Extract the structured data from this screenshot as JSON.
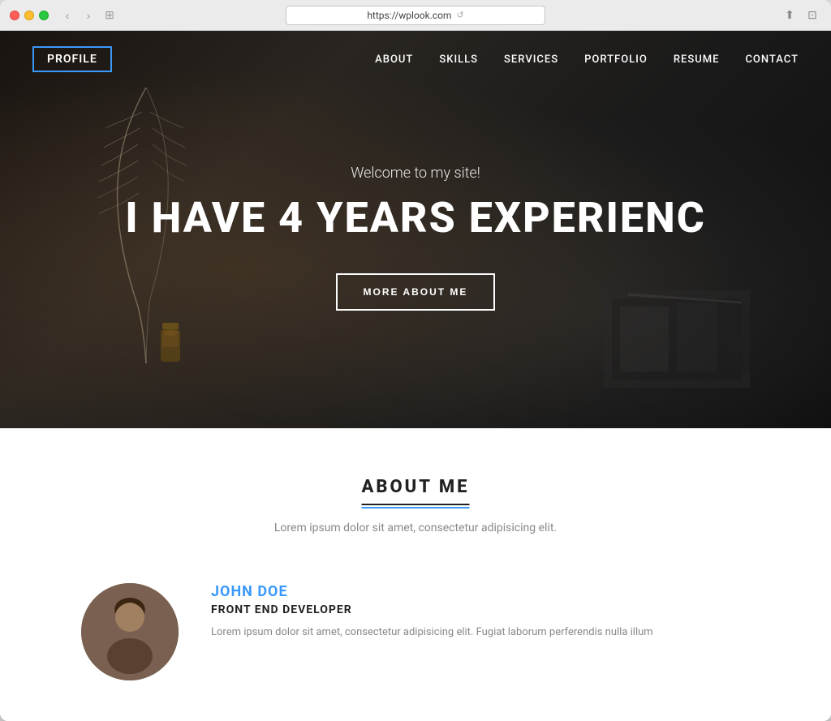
{
  "browser": {
    "url": "https://wplook.com",
    "back_btn": "‹",
    "forward_btn": "›",
    "tab_icon": "⊞",
    "share_icon": "⬆",
    "fullscreen_icon": "⊡"
  },
  "nav": {
    "logo": "PROFILE",
    "links": [
      {
        "label": "ABOUT",
        "href": "#about"
      },
      {
        "label": "SKILLS",
        "href": "#skills"
      },
      {
        "label": "SERVICES",
        "href": "#services"
      },
      {
        "label": "PORTFOLIO",
        "href": "#portfolio"
      },
      {
        "label": "RESUME",
        "href": "#resume"
      },
      {
        "label": "CONTACT",
        "href": "#contact"
      }
    ]
  },
  "hero": {
    "subtitle": "Welcome to my site!",
    "title": "I HAVE 4 YEARS EXPERIENC",
    "cta_label": "MORE ABOUT ME"
  },
  "about": {
    "section_title": "ABOUT ME",
    "section_desc": "Lorem ipsum dolor sit amet, consectetur adipisicing elit.",
    "profile": {
      "name": "JOHN DOE",
      "role": "FRONT END DEVELOPER",
      "bio": "Lorem ipsum dolor sit amet, consectetur adipisicing elit. Fugiat laborum perferendis nulla illum"
    }
  },
  "accent_color": "#3b99fc"
}
